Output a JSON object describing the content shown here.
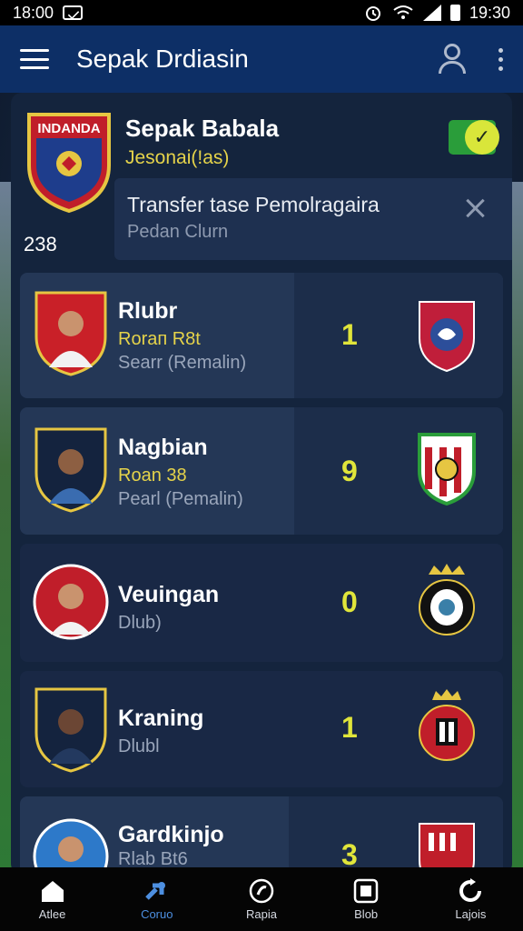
{
  "status_bar": {
    "time_left": "18:00",
    "time_right": "19:30"
  },
  "app_bar": {
    "title": "Sepak Drdiasin"
  },
  "league": {
    "crest_text": "INDANDA",
    "crest_number": "238",
    "name": "Sepak Babala",
    "subtitle": "Jesonai(!as)"
  },
  "notice": {
    "title": "Transfer tase Pemolragaira",
    "subtitle": "Pedan Clurn"
  },
  "players": [
    {
      "name": "Rlubr",
      "line2": "Roraп R8t",
      "line3": "Searr (Remalin)",
      "score": "1"
    },
    {
      "name": "Nagbian",
      "line2": "Roan 38",
      "line3": "Pearl (Pemalin)",
      "score": "9"
    },
    {
      "name": "Veuingan",
      "line2": "",
      "line3": "Dlub)",
      "score": "0"
    },
    {
      "name": "Kraning",
      "line2": "",
      "line3": "Dlubl",
      "score": "1"
    },
    {
      "name": "Gardkinjo",
      "line2": "",
      "line3": "Rlab Bt6",
      "score": "3"
    }
  ],
  "nav": [
    {
      "label": "Atlee",
      "icon": "home-icon"
    },
    {
      "label": "Coruo",
      "icon": "puzzle-icon"
    },
    {
      "label": "Rapia",
      "icon": "ball-icon"
    },
    {
      "label": "Blob",
      "icon": "square-icon"
    },
    {
      "label": "Lajois",
      "icon": "refresh-icon"
    }
  ],
  "colors": {
    "accent": "#e0e53a",
    "appbar": "#0d2f66",
    "panel": "#14243d",
    "active_nav": "#4d8fe0"
  }
}
